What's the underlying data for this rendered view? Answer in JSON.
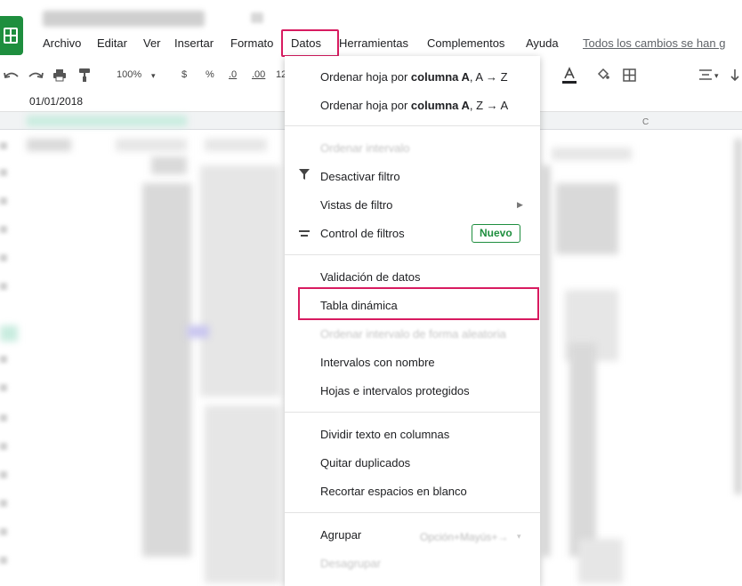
{
  "menubar": {
    "items": [
      "Archivo",
      "Editar",
      "Ver",
      "Insertar",
      "Formato",
      "Datos",
      "Herramientas",
      "Complementos",
      "Ayuda"
    ],
    "save_status": "Todos los cambios se han g"
  },
  "toolbar": {
    "zoom": "100%",
    "currency": "$",
    "percent": "%",
    "decimals_less": ".0",
    "decimals_more": ".00",
    "format_more": "12"
  },
  "formula_bar": {
    "value": "01/01/2018"
  },
  "data_menu": {
    "sort_az": {
      "prefix": "Ordenar hoja por ",
      "bold": "columna A",
      "suffix": ", A → Z"
    },
    "sort_za": {
      "prefix": "Ordenar hoja por ",
      "bold": "columna A",
      "suffix": ", Z → A"
    },
    "sort_range": "Ordenar intervalo",
    "filter_off": "Desactivar filtro",
    "filter_views": "Vistas de filtro",
    "slicer": "Control de filtros",
    "slicer_badge": "Nuevo",
    "validation": "Validación de datos",
    "pivot_table": "Tabla dinámica",
    "randomize": "Ordenar intervalo de forma aleatoria",
    "named_ranges": "Intervalos con nombre",
    "protected": "Hojas e intervalos protegidos",
    "split_text": "Dividir texto en columnas",
    "remove_dupes": "Quitar duplicados",
    "trim_spaces": "Recortar espacios en blanco",
    "group": "Agrupar",
    "group_shortcut": "Opción+Mayús+→",
    "ungroup": "Desagrupar"
  },
  "colors": {
    "highlight": "#d81b60",
    "badge": "#1e8e3e",
    "logo": "#1e8e3e"
  }
}
